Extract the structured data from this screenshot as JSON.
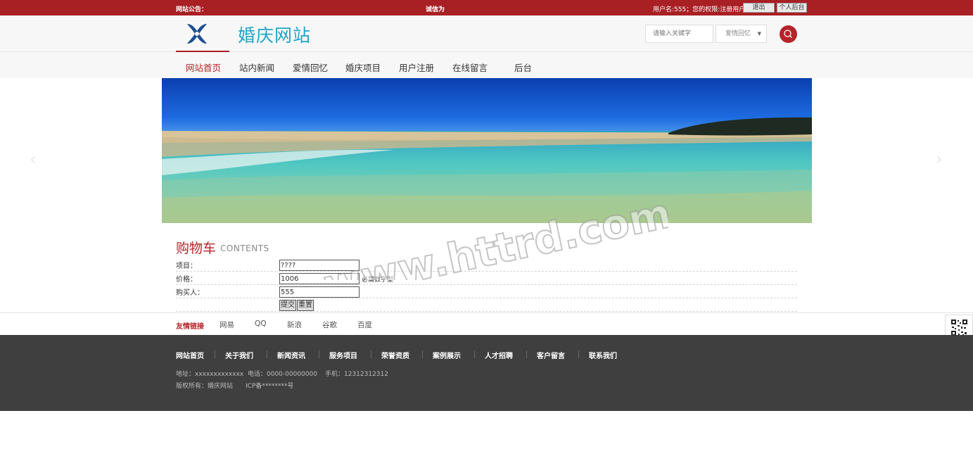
{
  "topbar": {
    "notice_label": "网站公告：",
    "notice_text": "诚信为",
    "user_info": "用户名:555；您的权限:注册用户",
    "logout_label": "退出",
    "admin_label": "个人后台"
  },
  "header": {
    "site_title": "婚庆网站",
    "search_placeholder": "请输入关键字",
    "search_select_value": "爱情回忆"
  },
  "nav": {
    "items": [
      {
        "label": "网站首页",
        "active": true
      },
      {
        "label": "站内新闻",
        "active": false
      },
      {
        "label": "爱情回忆",
        "active": false
      },
      {
        "label": "婚庆项目",
        "active": false
      },
      {
        "label": "用户注册",
        "active": false
      },
      {
        "label": "在线留言",
        "active": false
      },
      {
        "label": "后台",
        "active": false
      }
    ]
  },
  "banner": {
    "prev_icon": "‹",
    "next_icon": "›"
  },
  "cart": {
    "title": "购物车",
    "subtitle": "CONTENTS",
    "fields": [
      {
        "label": "项目：",
        "value": "????",
        "hint": ""
      },
      {
        "label": "价格：",
        "value": "1006",
        "hint": "必需数字型"
      },
      {
        "label": "购买人：",
        "value": "555",
        "hint": ""
      }
    ],
    "submit_label": "提交",
    "reset_label": "重置"
  },
  "links": {
    "label": "友情链接",
    "items": [
      "网易",
      "QQ",
      "新浪",
      "谷歌",
      "百度"
    ]
  },
  "footer": {
    "nav": [
      "网站首页",
      "关于我们",
      "新闻资讯",
      "服务项目",
      "荣誉资质",
      "案例展示",
      "人才招聘",
      "客户留言",
      "联系我们"
    ],
    "address": "地址：xxxxxxxxxxxxx",
    "phone": "电话：0000-00000000",
    "mobile": "手机：12312312312",
    "copyright": "版权所有：婚庆网站",
    "icp": "ICP备********号"
  },
  "watermark": "www.httrd.com",
  "colors": {
    "accent": "#a81f24",
    "title": "#20a5c9",
    "footer_bg": "#3f3f3f"
  }
}
